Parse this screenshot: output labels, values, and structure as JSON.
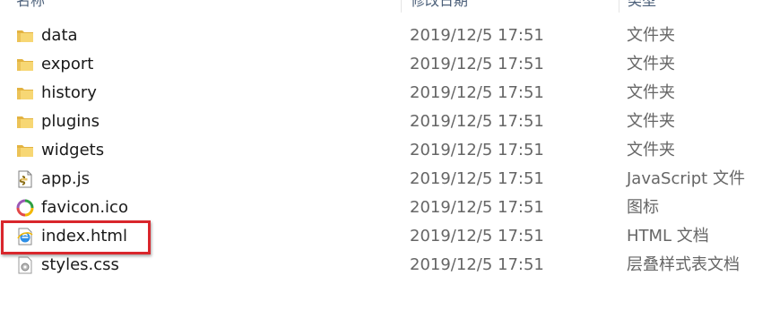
{
  "header": {
    "name_label": "名称",
    "date_label": "修改日期",
    "type_label": "类型"
  },
  "files": [
    {
      "name": "data",
      "date": "2019/12/5 17:51",
      "type": "文件夹",
      "icon": "folder-icon"
    },
    {
      "name": "export",
      "date": "2019/12/5 17:51",
      "type": "文件夹",
      "icon": "folder-icon"
    },
    {
      "name": "history",
      "date": "2019/12/5 17:51",
      "type": "文件夹",
      "icon": "folder-icon"
    },
    {
      "name": "plugins",
      "date": "2019/12/5 17:51",
      "type": "文件夹",
      "icon": "folder-icon"
    },
    {
      "name": "widgets",
      "date": "2019/12/5 17:51",
      "type": "文件夹",
      "icon": "folder-icon"
    },
    {
      "name": "app.js",
      "date": "2019/12/5 17:51",
      "type": "JavaScript 文件",
      "icon": "javascript-file-icon"
    },
    {
      "name": "favicon.ico",
      "date": "2019/12/5 17:51",
      "type": "图标",
      "icon": "ico-file-icon"
    },
    {
      "name": "index.html",
      "date": "2019/12/5 17:51",
      "type": "HTML 文档",
      "icon": "html-file-icon"
    },
    {
      "name": "styles.css",
      "date": "2019/12/5 17:51",
      "type": "层叠样式表文档",
      "icon": "css-file-icon"
    }
  ],
  "highlight": {
    "target": "index.html",
    "color": "#d9262c"
  },
  "colors": {
    "folder": "#f7d774",
    "folder_dark": "#e3b341",
    "text": "#1a1a1a",
    "secondary_text": "#666666"
  }
}
